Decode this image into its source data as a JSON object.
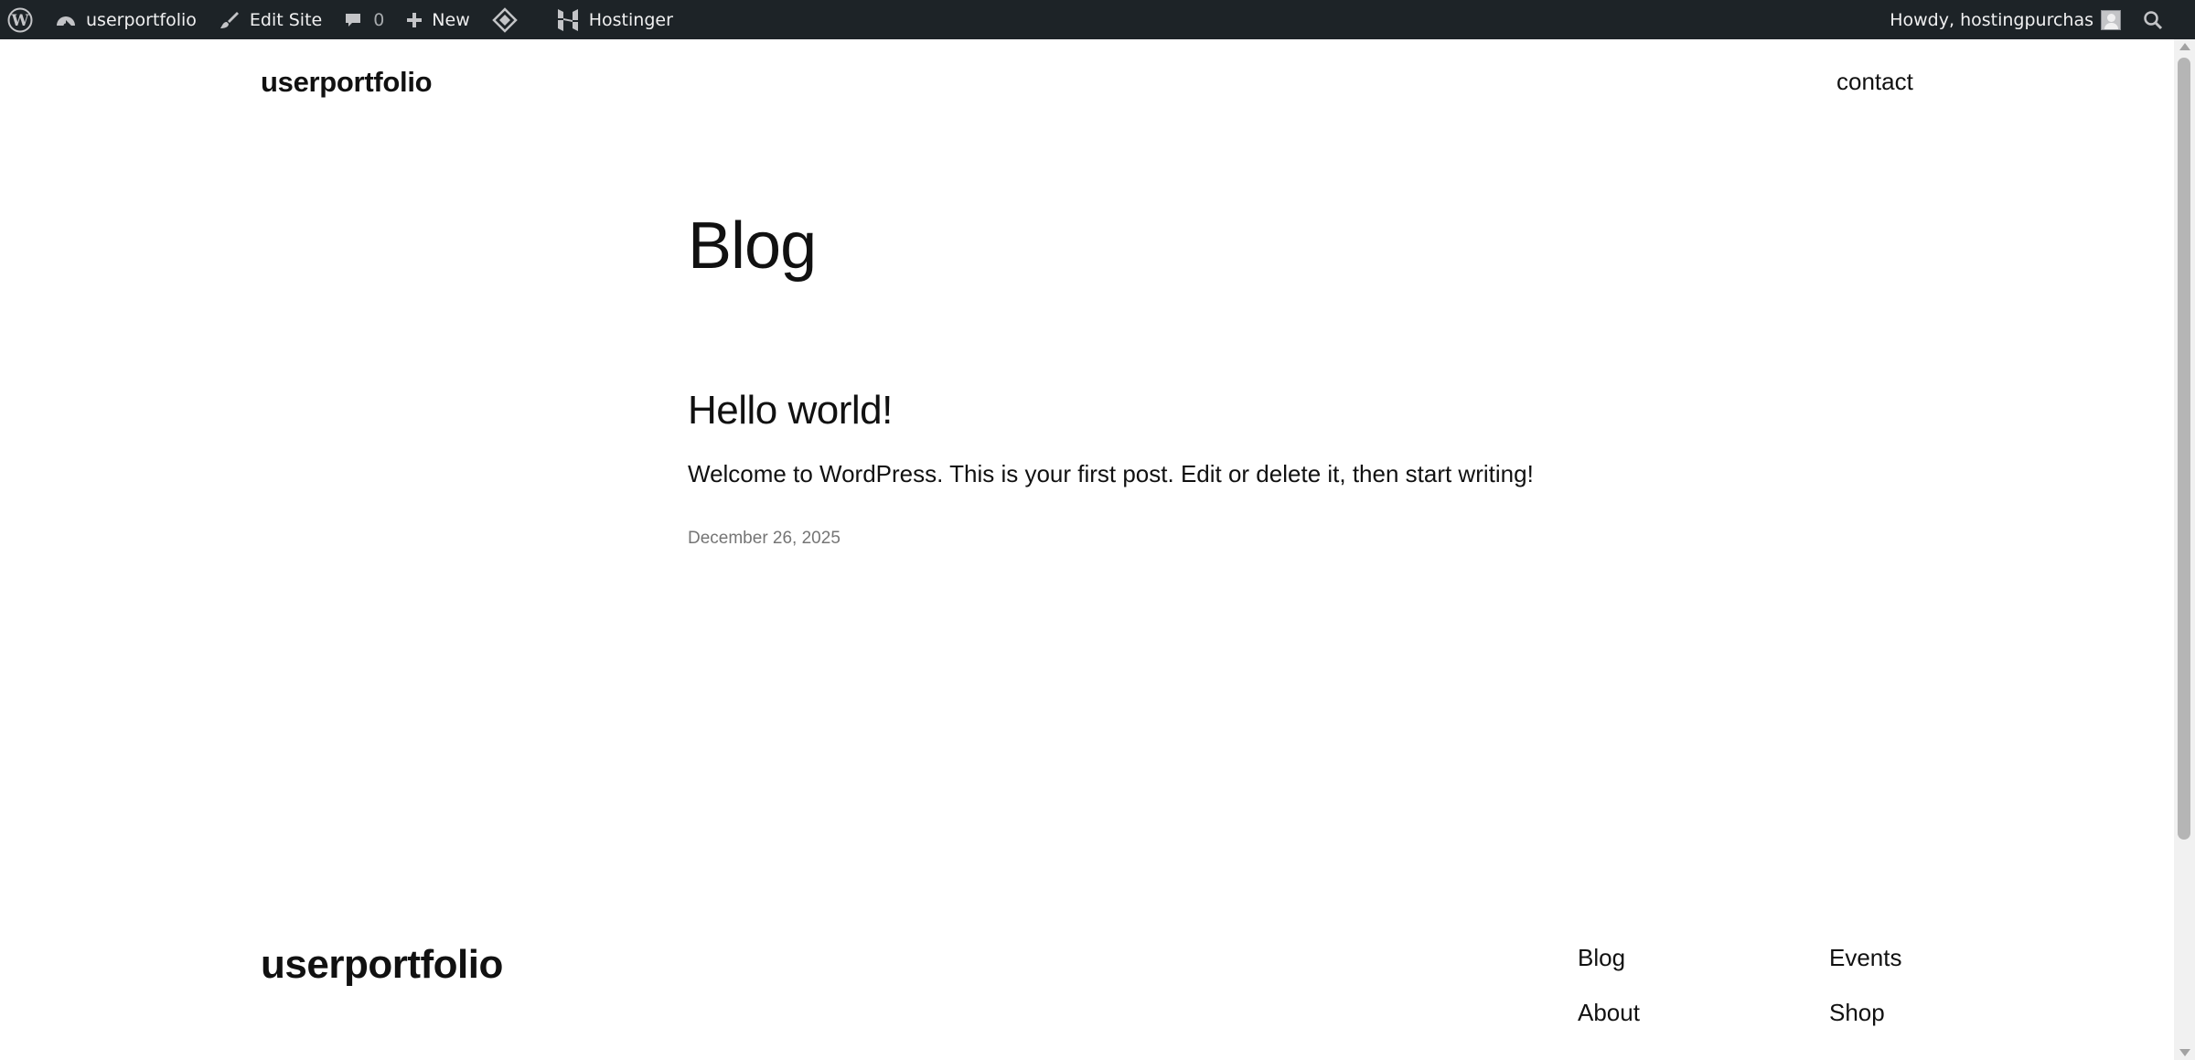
{
  "admin_bar": {
    "site_name": "userportfolio",
    "edit_site": "Edit Site",
    "comment_count": "0",
    "new_label": "New",
    "hostinger_label": "Hostinger",
    "howdy": "Howdy, hostingpurchas",
    "background_color": "#1d2327",
    "text_color": "#f0f0f1"
  },
  "header": {
    "site_title": "userportfolio",
    "nav": {
      "contact": "contact"
    }
  },
  "main": {
    "heading": "Blog",
    "posts": [
      {
        "title": "Hello world!",
        "excerpt": "Welcome to WordPress. This is your first post. Edit or delete it, then start writing!",
        "date": "December 26, 2025"
      }
    ]
  },
  "footer": {
    "site_title": "userportfolio",
    "links": {
      "blog": "Blog",
      "events": "Events",
      "about": "About",
      "shop": "Shop"
    }
  },
  "icons": {
    "wp_logo": "wordpress-logo-icon",
    "dashboard": "dashboard-icon",
    "edit_site": "brush-icon",
    "comments": "comment-icon",
    "new": "plus-icon",
    "diamond": "diamond-icon",
    "hostinger": "hostinger-logo-icon",
    "search": "search-icon",
    "avatar": "avatar-icon"
  }
}
